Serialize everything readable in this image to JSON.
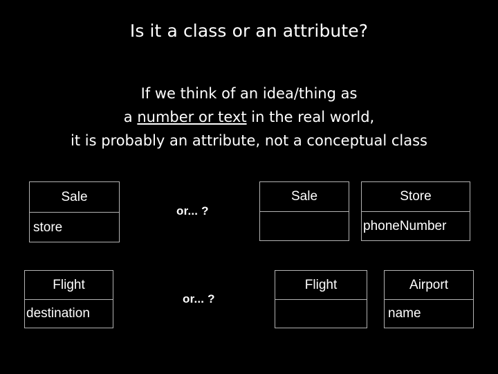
{
  "slide": {
    "background_color": "#000000",
    "text_color": "#ffffff",
    "border_color": "#b4b4b4",
    "title": "Is it a class or an attribute?",
    "body": {
      "line1": "If we think of an idea/thing as",
      "line2_prefix": "a ",
      "line2_underlined": "number or text",
      "line2_suffix": " in the real world,",
      "line3": "it is probably an attribute, not a conceptual class"
    }
  },
  "diagram": {
    "comparisons": [
      {
        "id": "sale-comparison",
        "connector": "or... ?",
        "left": [
          {
            "name": "Sale",
            "attributes": "store"
          }
        ],
        "right": [
          {
            "name": "Sale",
            "attributes": ""
          },
          {
            "name": "Store",
            "attributes": "phoneNumber"
          }
        ]
      },
      {
        "id": "flight-comparison",
        "connector": "or... ?",
        "left": [
          {
            "name": "Flight",
            "attributes": "destination"
          }
        ],
        "right": [
          {
            "name": "Flight",
            "attributes": ""
          },
          {
            "name": "Airport",
            "attributes": "name"
          }
        ]
      }
    ]
  }
}
